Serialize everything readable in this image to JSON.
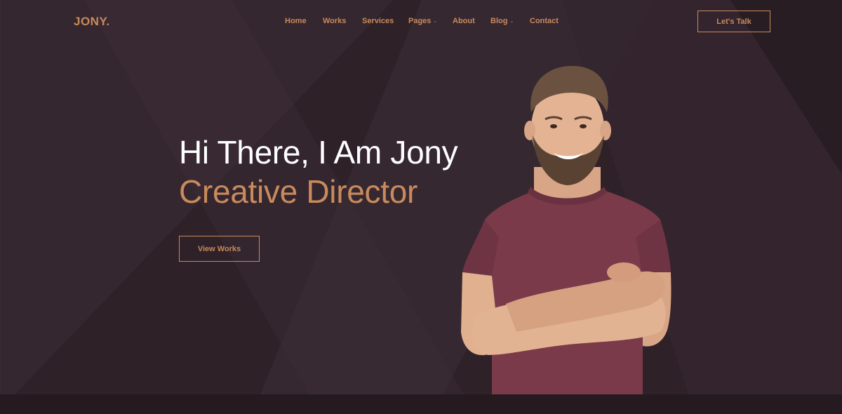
{
  "brand": {
    "name": "JONY."
  },
  "nav": {
    "items": [
      {
        "label": "Home",
        "dropdown": false
      },
      {
        "label": "Works",
        "dropdown": false
      },
      {
        "label": "Services",
        "dropdown": false
      },
      {
        "label": "Pages",
        "dropdown": true
      },
      {
        "label": "About",
        "dropdown": false
      },
      {
        "label": "Blog",
        "dropdown": true
      },
      {
        "label": "Contact",
        "dropdown": false
      }
    ],
    "dropdown_icon": "chevron-down-icon"
  },
  "header": {
    "cta_label": "Let's Talk"
  },
  "hero": {
    "greeting": "Hi There, I Am Jony",
    "role": "Creative Director",
    "button_label": "View Works"
  },
  "colors": {
    "accent": "#c98a5c",
    "background": "#2e2128",
    "background_light": "#3a2b33",
    "text_light": "#ffffff",
    "shirt": "#7a3a4a"
  }
}
